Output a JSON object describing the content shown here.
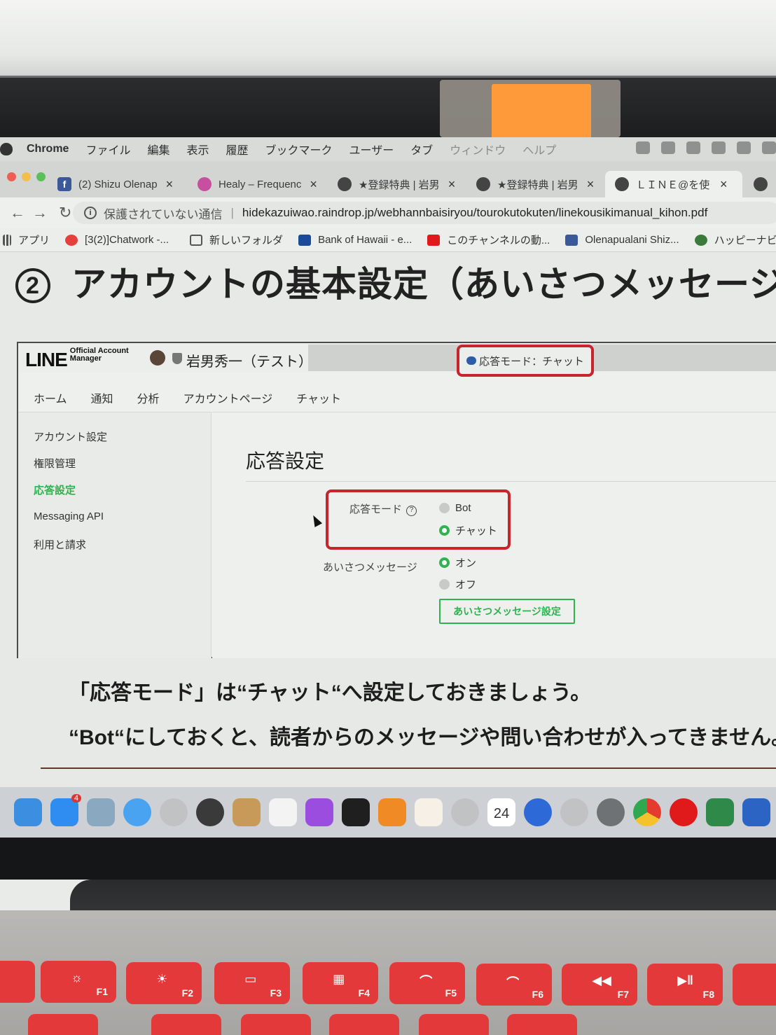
{
  "menubar": {
    "items": [
      "Chrome",
      "ファイル",
      "編集",
      "表示",
      "履歴",
      "ブックマーク",
      "ユーザー",
      "タブ",
      "ウィンドウ",
      "ヘルプ"
    ]
  },
  "tabs": [
    {
      "title": "(2) Shizu Olenap",
      "icon": "facebook-icon",
      "color": "#3b5998"
    },
    {
      "title": "Healy – Frequenc",
      "icon": "healy-icon",
      "color": "#c64fa0"
    },
    {
      "title": "★登録特典 | 岩男",
      "icon": "globe-icon",
      "color": "#444444"
    },
    {
      "title": "★登録特典 | 岩男",
      "icon": "globe-icon",
      "color": "#444444"
    },
    {
      "title": "ＬＩＮＥ@を使っ",
      "icon": "globe-icon",
      "color": "#444444",
      "active": true
    }
  ],
  "address": {
    "security": "保護されていない通信",
    "url": "hidekazuiwao.raindrop.jp/webhannbaisiryou/tourokutokuten/linekousikimanual_kihon.pdf"
  },
  "bookmarks": [
    {
      "label": "アプリ",
      "icon": "apps-grid-icon"
    },
    {
      "label": "[3(2)]Chatwork -...",
      "icon": "chatwork-icon"
    },
    {
      "label": "新しいフォルダ",
      "icon": "folder-icon"
    },
    {
      "label": "Bank of Hawaii - e...",
      "icon": "bank-icon"
    },
    {
      "label": "このチャンネルの動...",
      "icon": "youtube-icon"
    },
    {
      "label": "Olenapualani Shiz...",
      "icon": "facebook-icon"
    },
    {
      "label": "ハッピーナビ",
      "icon": "happy-icon"
    }
  ],
  "doc": {
    "number": "②",
    "title": "アカウントの基本設定（あいさつメッセージ）",
    "caption1": "「応答モード」は“チャット“へ設定しておきましょう。",
    "caption2": "“Bot“にしておくと、読者からのメッセージや問い合わせが入ってきません。"
  },
  "line_admin": {
    "logo": "LINE",
    "logo_sub1": "Official Account",
    "logo_sub2": "Manager",
    "account_name": "岩男秀一（テスト）",
    "mode_pill": "応答モード：チャット",
    "nav": [
      "ホーム",
      "通知",
      "分析",
      "アカウントページ",
      "チャット"
    ],
    "sidebar": [
      {
        "label": "アカウント設定",
        "active": false
      },
      {
        "label": "権限管理",
        "active": false
      },
      {
        "label": "応答設定",
        "active": true
      },
      {
        "label": "Messaging API",
        "active": false
      },
      {
        "label": "利用と請求",
        "active": false
      }
    ],
    "page_title": "応答設定",
    "mode_label": "応答モード",
    "mode_options": [
      "Bot",
      "チャット"
    ],
    "mode_selected": "チャット",
    "greeting_label": "あいさつメッセージ",
    "greeting_options": [
      "オン",
      "オフ"
    ],
    "greeting_selected": "オン",
    "greeting_button": "あいさつメッセージ設定"
  },
  "dock": {
    "apps": [
      "finder-icon",
      "app-store-icon",
      "preview-icon",
      "safari-icon",
      "disabled-app-icon",
      "obs-icon",
      "contacts-icon",
      "music-icon",
      "podcasts-icon",
      "apple-tv-icon",
      "books-icon",
      "photos-icon",
      "disabled-app-icon",
      "calendar-icon",
      "quicktime-icon",
      "disabled-app-icon",
      "system-preferences-icon",
      "chrome-icon",
      "opera-icon",
      "disabled-app-icon",
      "disabled-app-icon",
      "onenote-icon"
    ],
    "app_store_badge": "4",
    "calendar_day": "24"
  },
  "keyboard": {
    "fkeys": [
      "F1",
      "F2",
      "F3",
      "F4",
      "F5",
      "F6",
      "F7",
      "F8"
    ]
  }
}
